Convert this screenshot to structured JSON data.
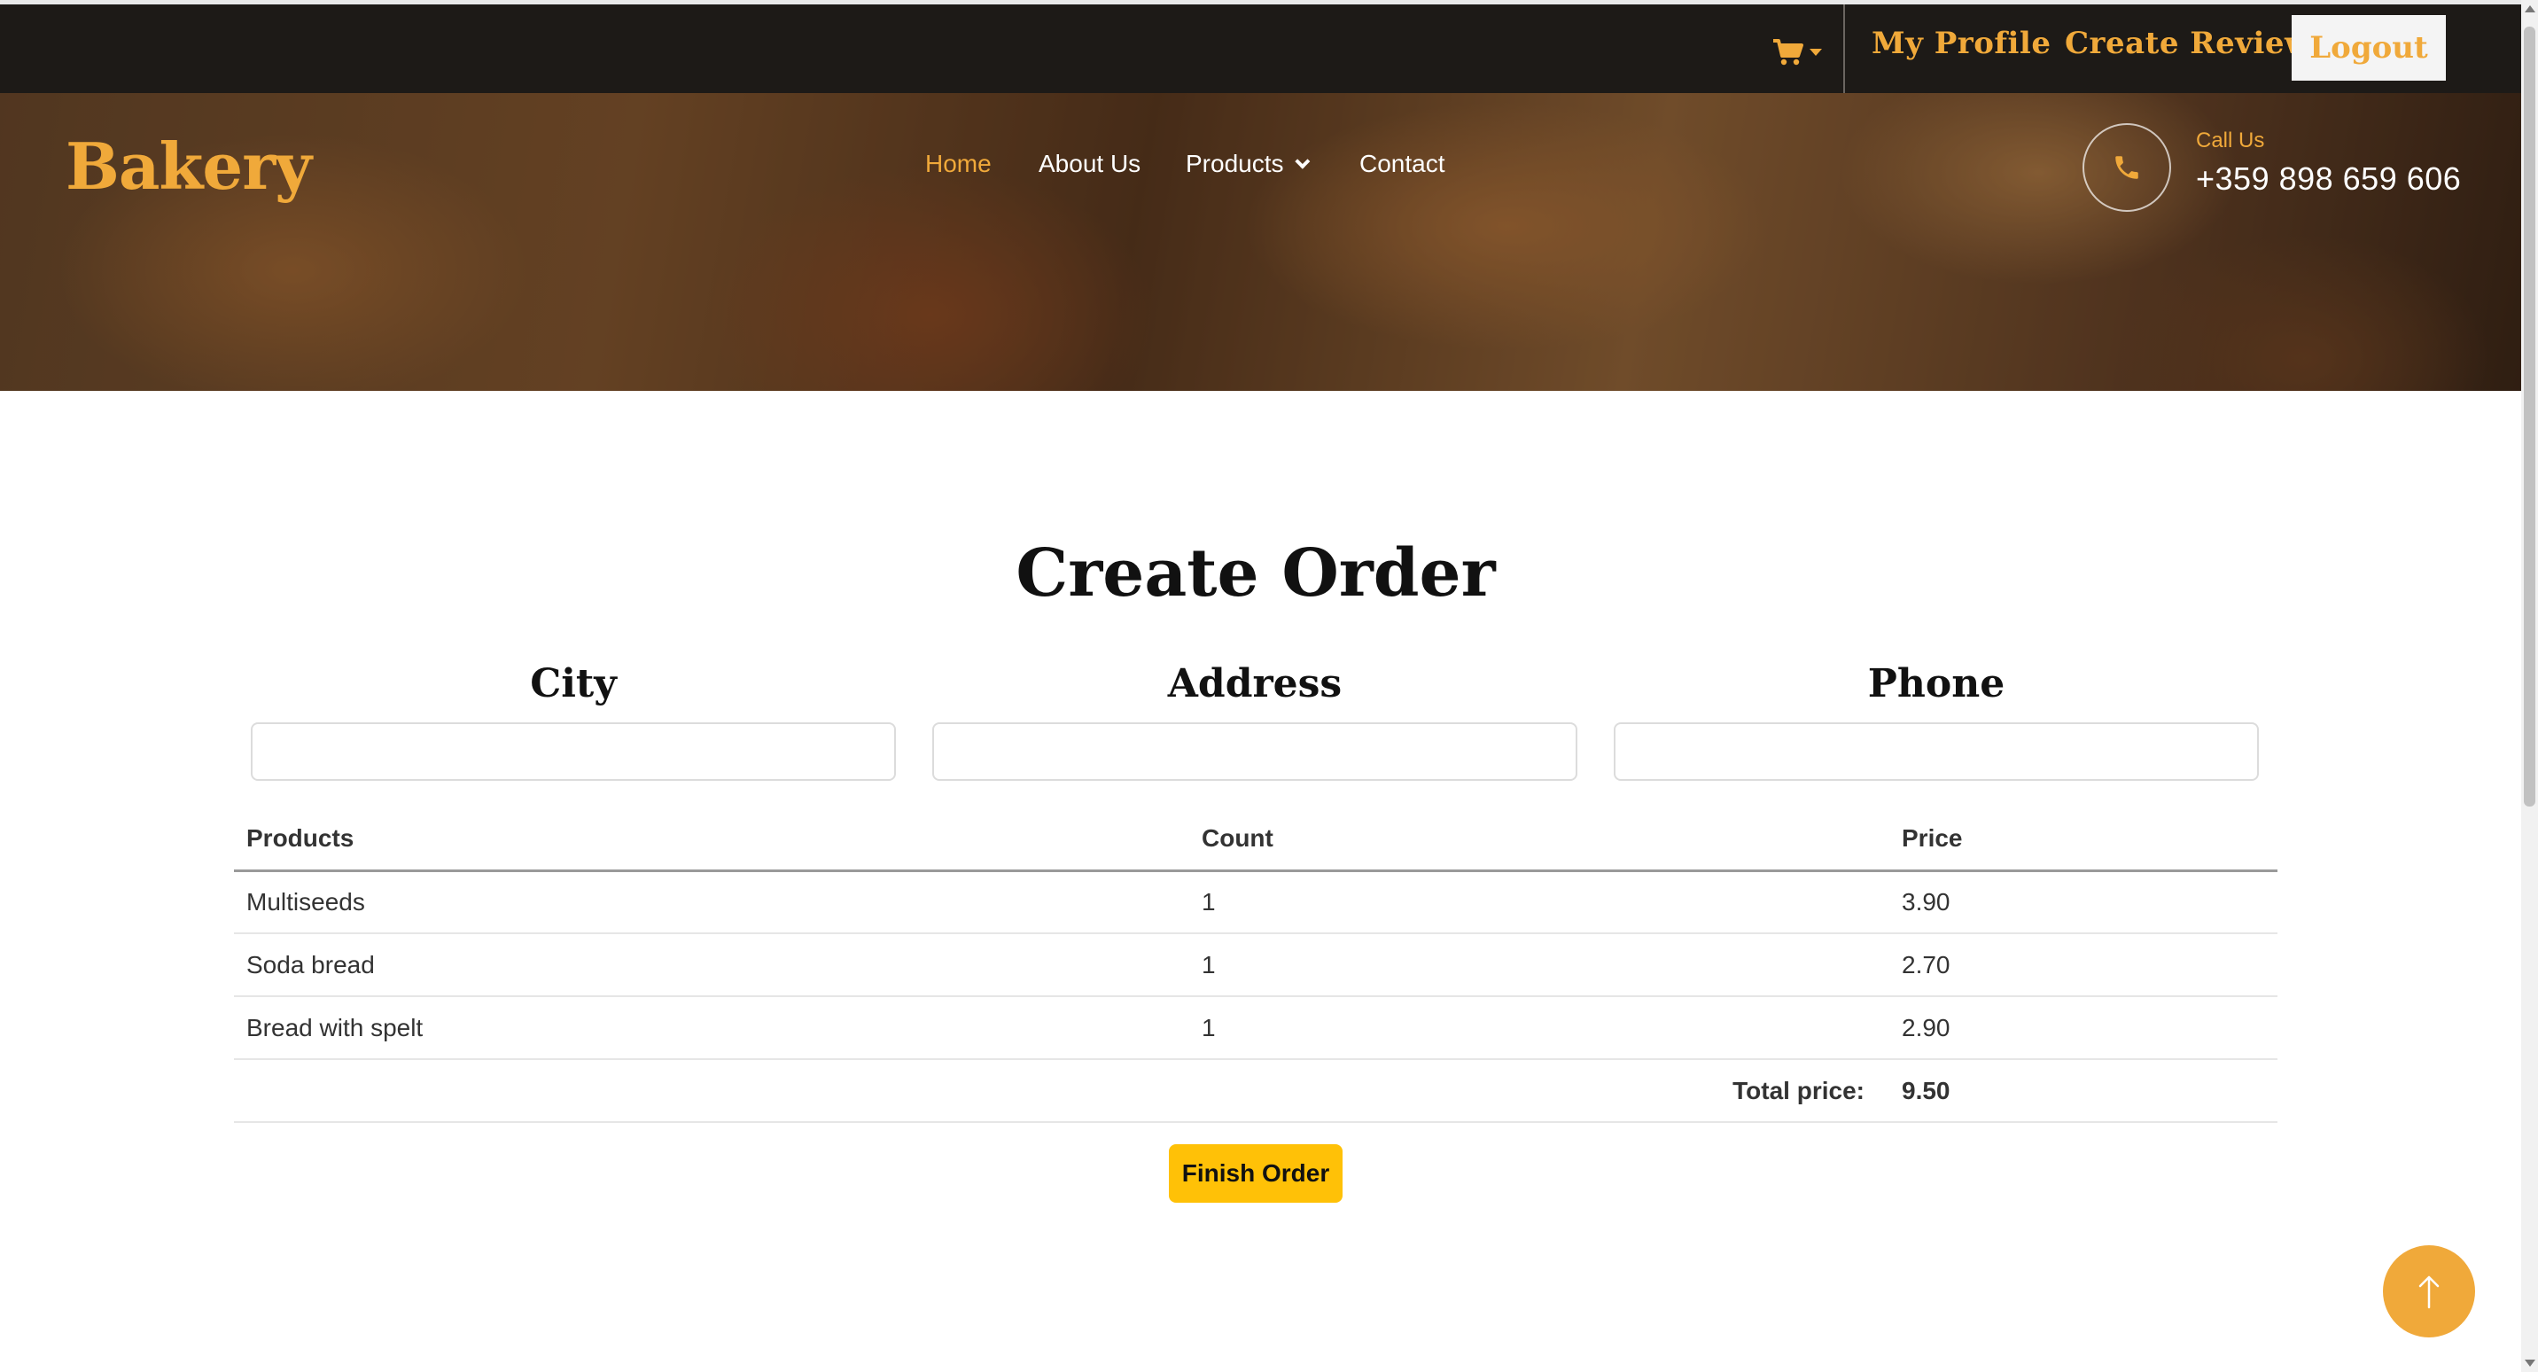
{
  "topbar": {
    "cart_icon": "shopping-cart-icon",
    "links": [
      "My Profile",
      "Create Review"
    ],
    "logout_label": "Logout"
  },
  "header": {
    "brand": "Bakery",
    "nav": [
      "Home",
      "About Us",
      "Products",
      "Contact"
    ],
    "active_nav": "Home",
    "call_label": "Call Us",
    "call_number": "+359 898 659 606"
  },
  "main": {
    "title": "Create Order",
    "fields": {
      "city_label": "City",
      "city_value": "",
      "address_label": "Address",
      "address_value": "",
      "phone_label": "Phone",
      "phone_value": ""
    },
    "table": {
      "headers": [
        "Products",
        "Count",
        "Price"
      ],
      "rows": [
        [
          "Multiseeds",
          "1",
          "3.90"
        ],
        [
          "Soda bread",
          "1",
          "2.70"
        ],
        [
          "Bread with spelt",
          "1",
          "2.90"
        ]
      ],
      "total_label": "Total price:",
      "total_value": "9.50"
    },
    "finish_button": "Finish Order"
  },
  "colors": {
    "accent": "#f0a93a",
    "button": "#ffc107",
    "topbar_bg": "#1d1a17"
  }
}
